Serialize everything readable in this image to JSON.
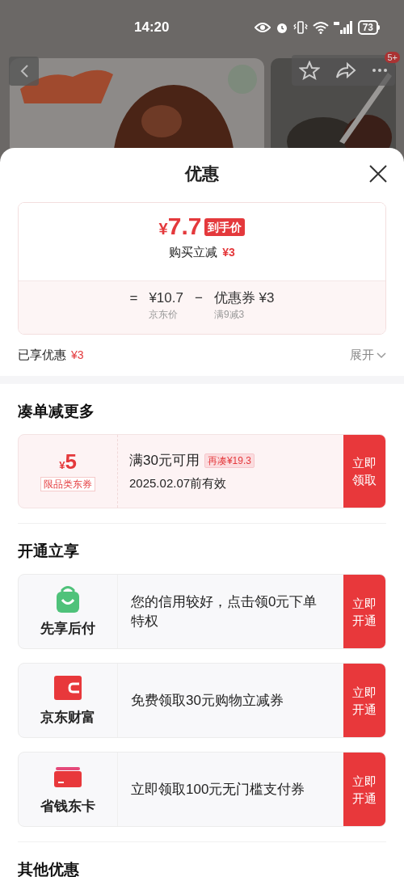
{
  "status_bar": {
    "time": "14:20",
    "battery": "73"
  },
  "toolbar": {
    "badge": "5+"
  },
  "sheet": {
    "title": "优惠",
    "price_card": {
      "currency": "¥",
      "price": "7.7",
      "price_tag": "到手价",
      "subtitle": "购买立减",
      "subtitle_amount": "¥3",
      "equals": "=",
      "base_price": "¥10.7",
      "base_label": "京东价",
      "minus": "−",
      "coupon": "优惠券 ¥3",
      "coupon_label": "满9减3"
    },
    "enjoyed": {
      "label": "已享优惠",
      "amount": "¥3",
      "expand": "展开"
    },
    "sections": [
      {
        "title": "凑单减更多",
        "items": [
          {
            "kind": "coupon",
            "currency": "¥",
            "amount": "5",
            "scope": "限品类东券",
            "condition": "满30元可用",
            "tag": "再凑¥19.3",
            "validity": "2025.02.07前有效",
            "button": "立即领取"
          }
        ]
      },
      {
        "title": "开通立享",
        "items": [
          {
            "kind": "service",
            "name": "先享后付",
            "text": "您的信用较好，点击领0元下单特权",
            "button": "立即开通"
          },
          {
            "kind": "service",
            "name": "京东财富",
            "text": "免费领取30元购物立减券",
            "button": "立即开通"
          },
          {
            "kind": "service",
            "name": "省钱东卡",
            "text": "立即领取100元无门槛支付券",
            "button": "立即开通"
          }
        ]
      },
      {
        "title": "其他优惠"
      }
    ]
  }
}
